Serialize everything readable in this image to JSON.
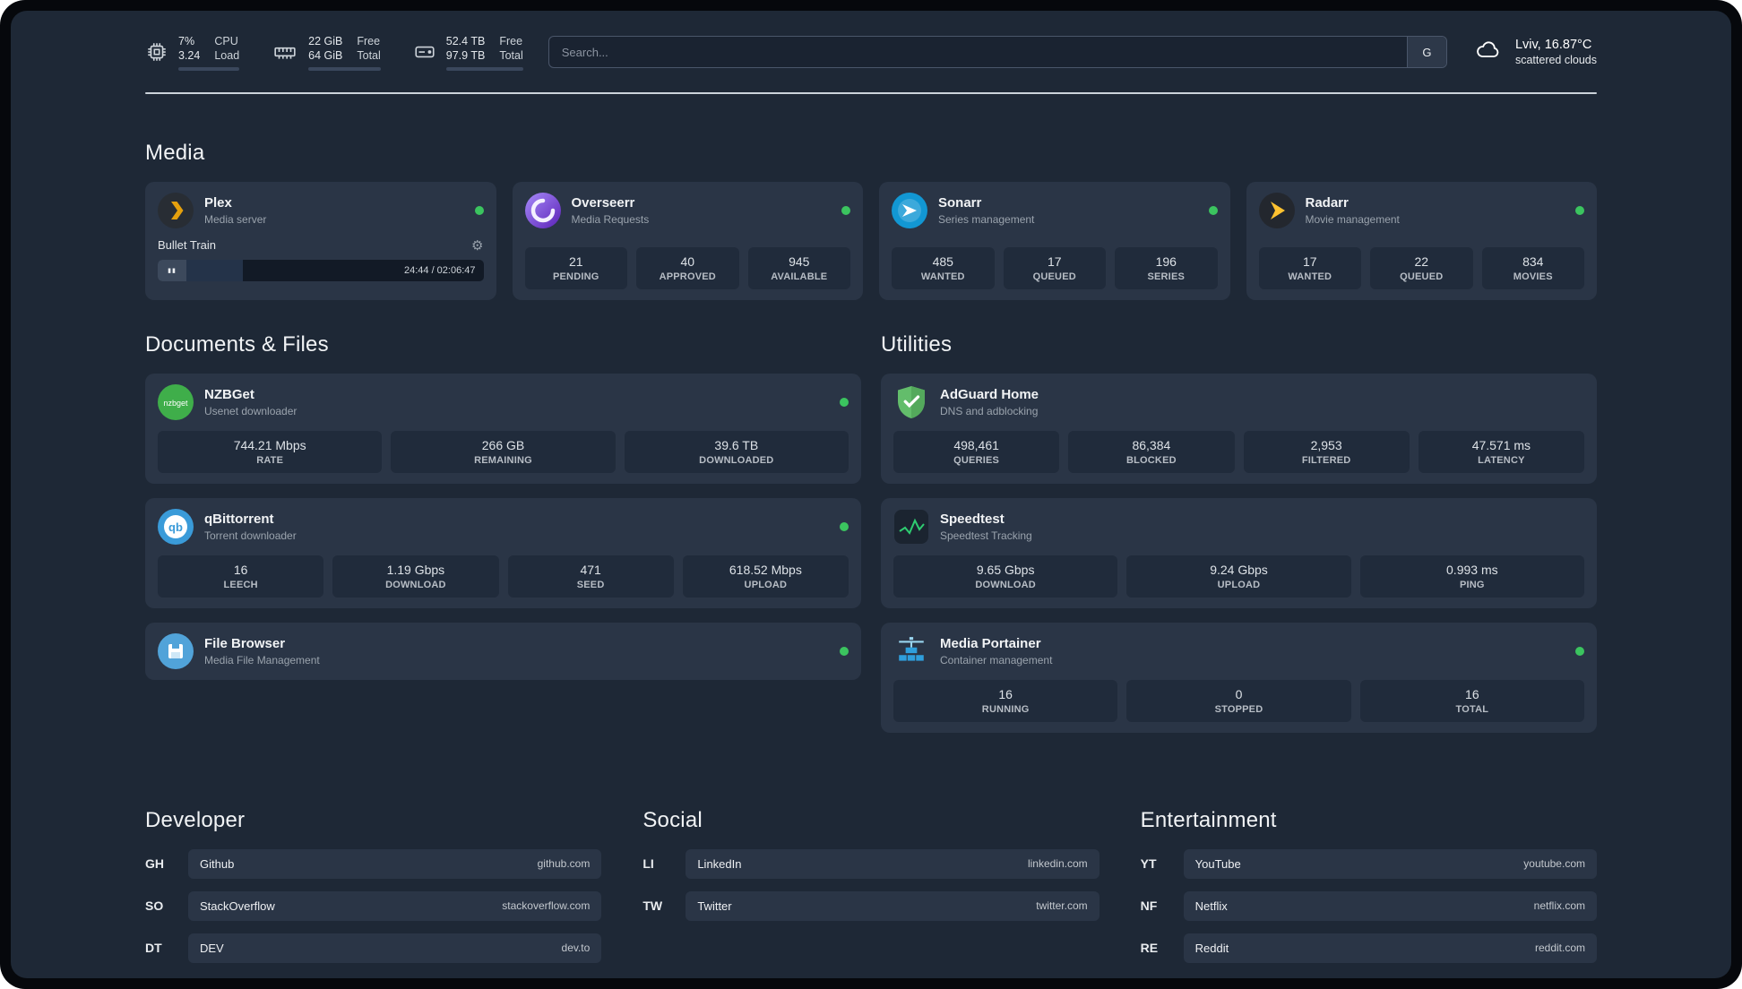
{
  "header": {
    "cpu": {
      "value1": "7%",
      "value2": "3.24",
      "label1": "CPU",
      "label2": "Load"
    },
    "ram": {
      "value1": "22 GiB",
      "value2": "64 GiB",
      "label1": "Free",
      "label2": "Total"
    },
    "disk": {
      "value1": "52.4 TB",
      "value2": "97.9 TB",
      "label1": "Free",
      "label2": "Total"
    },
    "search": {
      "placeholder": "Search...",
      "button": "G"
    },
    "weather": {
      "location": "Lviv, 16.87°C",
      "condition": "scattered clouds"
    }
  },
  "icons": {
    "gear": "⚙",
    "pause": "▮▮"
  },
  "colors": {
    "panel_background": "#1e2836",
    "card_background": "#2a3546",
    "tile_background": "#202b3b",
    "status_online": "#3bc45f",
    "plex_amber": "#e5a00d"
  },
  "media": {
    "title": "Media",
    "plex": {
      "name": "Plex",
      "subtitle": "Media server",
      "now_playing": "Bullet Train",
      "time": "24:44 / 02:06:47"
    },
    "overseerr": {
      "name": "Overseerr",
      "subtitle": "Media Requests",
      "stats": [
        {
          "value": "21",
          "label": "PENDING"
        },
        {
          "value": "40",
          "label": "APPROVED"
        },
        {
          "value": "945",
          "label": "AVAILABLE"
        }
      ]
    },
    "sonarr": {
      "name": "Sonarr",
      "subtitle": "Series management",
      "stats": [
        {
          "value": "485",
          "label": "WANTED"
        },
        {
          "value": "17",
          "label": "QUEUED"
        },
        {
          "value": "196",
          "label": "SERIES"
        }
      ]
    },
    "radarr": {
      "name": "Radarr",
      "subtitle": "Movie management",
      "stats": [
        {
          "value": "17",
          "label": "WANTED"
        },
        {
          "value": "22",
          "label": "QUEUED"
        },
        {
          "value": "834",
          "label": "MOVIES"
        }
      ]
    }
  },
  "documents": {
    "title": "Documents & Files",
    "nzbget": {
      "name": "NZBGet",
      "subtitle": "Usenet downloader",
      "stats": [
        {
          "value": "744.21 Mbps",
          "label": "RATE"
        },
        {
          "value": "266 GB",
          "label": "REMAINING"
        },
        {
          "value": "39.6 TB",
          "label": "DOWNLOADED"
        }
      ]
    },
    "qbittorrent": {
      "name": "qBittorrent",
      "subtitle": "Torrent downloader",
      "stats": [
        {
          "value": "16",
          "label": "LEECH"
        },
        {
          "value": "1.19 Gbps",
          "label": "DOWNLOAD"
        },
        {
          "value": "471",
          "label": "SEED"
        },
        {
          "value": "618.52 Mbps",
          "label": "UPLOAD"
        }
      ]
    },
    "filebrowser": {
      "name": "File Browser",
      "subtitle": "Media File Management"
    }
  },
  "utilities": {
    "title": "Utilities",
    "adguard": {
      "name": "AdGuard Home",
      "subtitle": "DNS and adblocking",
      "stats": [
        {
          "value": "498,461",
          "label": "QUERIES"
        },
        {
          "value": "86,384",
          "label": "BLOCKED"
        },
        {
          "value": "2,953",
          "label": "FILTERED"
        },
        {
          "value": "47.571 ms",
          "label": "LATENCY"
        }
      ]
    },
    "speedtest": {
      "name": "Speedtest",
      "subtitle": "Speedtest Tracking",
      "stats": [
        {
          "value": "9.65 Gbps",
          "label": "DOWNLOAD"
        },
        {
          "value": "9.24 Gbps",
          "label": "UPLOAD"
        },
        {
          "value": "0.993 ms",
          "label": "PING"
        }
      ]
    },
    "portainer": {
      "name": "Media Portainer",
      "subtitle": "Container management",
      "stats": [
        {
          "value": "16",
          "label": "RUNNING"
        },
        {
          "value": "0",
          "label": "STOPPED"
        },
        {
          "value": "16",
          "label": "TOTAL"
        }
      ]
    }
  },
  "bookmarks": [
    {
      "title": "Developer",
      "items": [
        {
          "abbr": "GH",
          "name": "Github",
          "url": "github.com"
        },
        {
          "abbr": "SO",
          "name": "StackOverflow",
          "url": "stackoverflow.com"
        },
        {
          "abbr": "DT",
          "name": "DEV",
          "url": "dev.to"
        }
      ]
    },
    {
      "title": "Social",
      "items": [
        {
          "abbr": "LI",
          "name": "LinkedIn",
          "url": "linkedin.com"
        },
        {
          "abbr": "TW",
          "name": "Twitter",
          "url": "twitter.com"
        }
      ]
    },
    {
      "title": "Entertainment",
      "items": [
        {
          "abbr": "YT",
          "name": "YouTube",
          "url": "youtube.com"
        },
        {
          "abbr": "NF",
          "name": "Netflix",
          "url": "netflix.com"
        },
        {
          "abbr": "RE",
          "name": "Reddit",
          "url": "reddit.com"
        }
      ]
    }
  ]
}
